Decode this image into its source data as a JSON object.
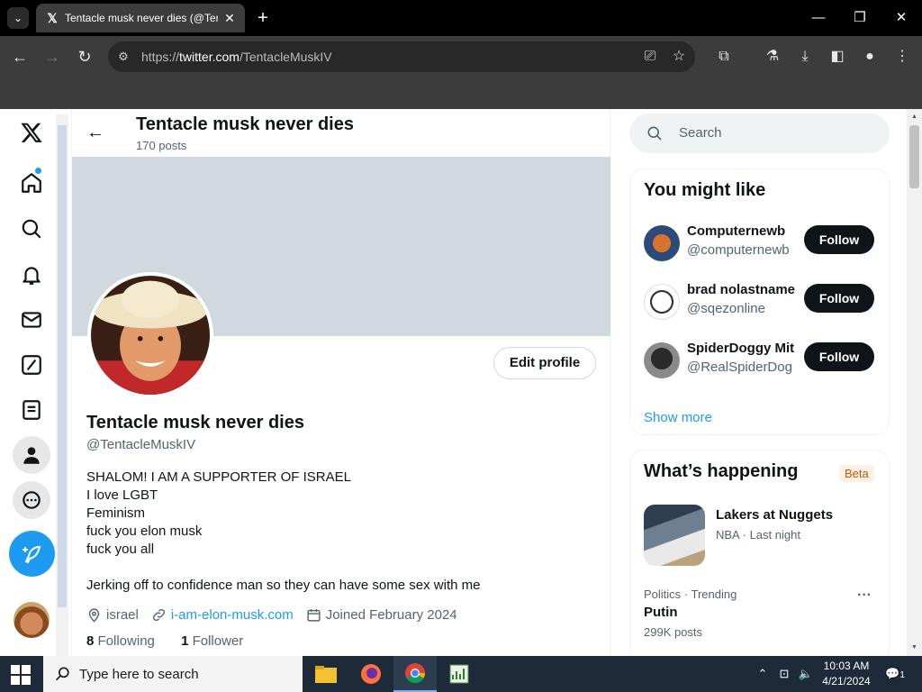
{
  "browser": {
    "tab_title": "Tentacle musk never dies (@TentacleMuskIV) / X",
    "url_prefix": "https://",
    "url_domain": "twitter.com",
    "url_path": "/TentacleMuskIV"
  },
  "profile_header": {
    "name": "Tentacle musk never dies",
    "post_count": "170 posts"
  },
  "profile": {
    "edit_label": "Edit profile",
    "name": "Tentacle musk never dies",
    "handle": "@TentacleMuskIV",
    "bio_lines": [
      "SHALOM! I AM A SUPPORTER OF ISRAEL",
      "I love LGBT",
      "Feminism",
      "fuck you elon musk",
      "fuck you all",
      "",
      "Jerking off to  confidence man so they can have some sex with me"
    ],
    "location": "israel",
    "website": "i-am-elon-musk.com",
    "joined": "Joined February 2024",
    "following_count": "8",
    "following_label": "Following",
    "followers_count": "1",
    "followers_label": "Follower"
  },
  "search": {
    "placeholder": "Search"
  },
  "who_to_follow": {
    "title": "You might like",
    "users": [
      {
        "name": "Computernewb",
        "handle": "@computernewb",
        "button": "Follow"
      },
      {
        "name": "brad nolastname",
        "handle": "@sqezonline",
        "button": "Follow"
      },
      {
        "name": "SpiderDoggy Mit",
        "handle": "@RealSpiderDog",
        "button": "Follow"
      }
    ],
    "show_more": "Show more"
  },
  "trends": {
    "title": "What’s happening",
    "badge": "Beta",
    "items": [
      {
        "title": "Lakers at Nuggets",
        "meta": "NBA · Last night"
      },
      {
        "category": "Politics · Trending",
        "title": "Putin",
        "posts": "299K posts"
      }
    ]
  },
  "taskbar": {
    "search_text": "Type here to search",
    "time": "10:03 AM",
    "date": "4/21/2024",
    "notifications": "1"
  },
  "colors": {
    "accent": "#1d9bf0",
    "banner": "#cfd9de",
    "text_secondary": "#536471",
    "follow_button": "#0f1419"
  }
}
